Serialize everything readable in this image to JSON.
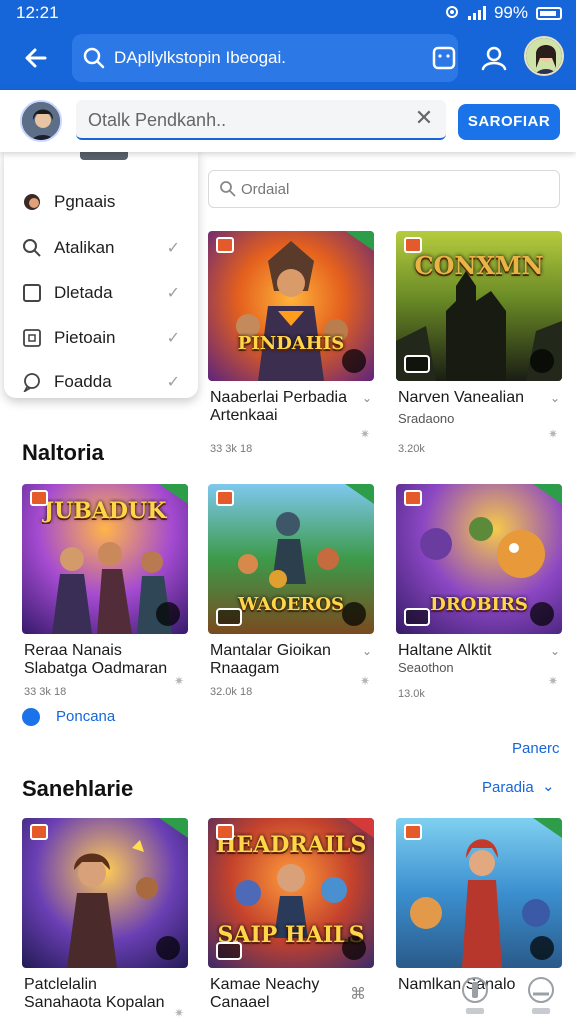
{
  "status_bar": {
    "time": "12:21",
    "battery": "99%"
  },
  "app_bar": {
    "search_text": "DApllylkstopin Ibeogai."
  },
  "panel": {
    "placeholder": "Otalk Pendkanh..",
    "button_label": "SAROFIAR"
  },
  "dropdown": {
    "items": [
      {
        "label": "Pgnaais",
        "icon": "avatar-icon",
        "checked": false
      },
      {
        "label": "Atalikan",
        "icon": "search-icon",
        "checked": true
      },
      {
        "label": "Dletada",
        "icon": "square-icon",
        "checked": true
      },
      {
        "label": "Pietoain",
        "icon": "image-icon",
        "checked": true
      },
      {
        "label": "Foadda",
        "icon": "chat-icon",
        "checked": true
      }
    ]
  },
  "filter": {
    "placeholder": "Ordaial"
  },
  "sections": {
    "top_cards": [
      {
        "art_title": "PINDAHIS",
        "title": "Naaberlai Perbadia Artenkaai",
        "subtitle": "",
        "meta": "33 3k 18",
        "colors": [
          "#f07b1e",
          "#6b2a89"
        ]
      },
      {
        "art_title": "CONXMN",
        "title": "Narven Vanealian",
        "subtitle": "Sradaono",
        "meta": "3.20k",
        "colors": [
          "#8aa52f",
          "#1c1f18"
        ]
      }
    ],
    "section1": {
      "title": "Naltoria",
      "cards": [
        {
          "art_title": "JUBADUK",
          "title": "Reraa Nanais Slabatga Oadmaran",
          "subtitle": "",
          "meta": "33 3k 18",
          "colors": [
            "#6d2fb0",
            "#f0812b"
          ]
        },
        {
          "art_title": "WAOEROS",
          "title": "Mantalar Gioikan Rnaagam",
          "subtitle": "",
          "meta": "32.0k 18",
          "colors": [
            "#2f7f3f",
            "#d6792a"
          ]
        },
        {
          "art_title": "DROBIRS",
          "title": "Haltane Alktit",
          "subtitle": "Seaothon",
          "meta": "13.0k",
          "colors": [
            "#7a3fb8",
            "#e8922e"
          ]
        }
      ],
      "promo_label": "Poncana",
      "see_more": "Panerc"
    },
    "section2": {
      "title": "Sanehlarie",
      "see_more": "Paradia",
      "cards": [
        {
          "art_title": "",
          "title": "Patclelalin Sanahaota Kopalan",
          "subtitle": "",
          "meta": "",
          "colors": [
            "#3a2f8f",
            "#f09a2b"
          ]
        },
        {
          "art_title": "SAIP HAILS",
          "title": "Kamae Neachy Canaael",
          "subtitle": "",
          "meta": "",
          "colors": [
            "#c4422c",
            "#3b2a6a"
          ]
        },
        {
          "art_title": "",
          "title": "Namlkan Sanalo",
          "subtitle": "",
          "meta": "",
          "colors": [
            "#2a87c9",
            "#d74f3a"
          ]
        }
      ]
    }
  }
}
